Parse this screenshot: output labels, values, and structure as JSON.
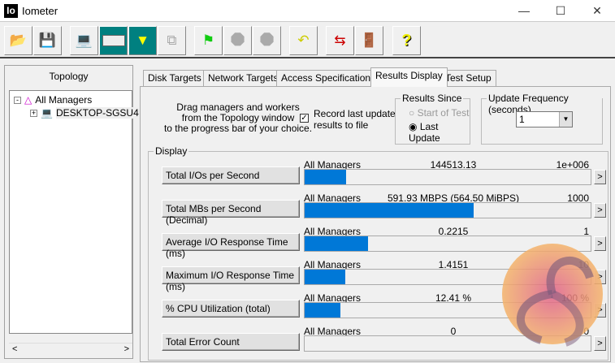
{
  "window": {
    "title": "Iometer",
    "icon_text": "Io"
  },
  "toolbar": {
    "buttons": [
      "open",
      "save",
      "start-new-manager",
      "new-disk-worker",
      "new-network-worker",
      "copy-worker",
      "start-tests",
      "stop",
      "stop-all",
      "reset-workers",
      "connect",
      "exit",
      "help"
    ]
  },
  "topology": {
    "title": "Topology",
    "root": "All Managers",
    "child": "DESKTOP-SGSU4"
  },
  "tabs": [
    "Disk Targets",
    "Network Targets",
    "Access Specifications",
    "Results Display",
    "Test Setup"
  ],
  "results": {
    "instructions": [
      "Drag managers and workers",
      "from the Topology window",
      "to the progress bar of your choice."
    ],
    "record_label": [
      "Record last update",
      "results to file"
    ],
    "record_checked": true,
    "results_since": {
      "title": "Results Since",
      "options": [
        "Start of Test",
        "Last Update"
      ],
      "selected": "Last Update"
    },
    "update_frequency": {
      "title": "Update Frequency (seconds)",
      "value": "1"
    },
    "display_title": "Display",
    "rows": [
      {
        "label": "Total I/Os per Second",
        "manager": "All Managers",
        "value": "144513.13",
        "max": "1e+006",
        "fraction": 0.1445
      },
      {
        "label": "Total MBs per Second (Decimal)",
        "manager": "All Managers",
        "value": "591.93 MBPS (564.50 MiBPS)",
        "max": "1000",
        "fraction": 0.592
      },
      {
        "label": "Average I/O Response Time (ms)",
        "manager": "All Managers",
        "value": "0.2215",
        "max": "1",
        "fraction": 0.2215
      },
      {
        "label": "Maximum I/O Response Time (ms)",
        "manager": "All Managers",
        "value": "1.4151",
        "max": "10",
        "fraction": 0.1415
      },
      {
        "label": "% CPU Utilization (total)",
        "manager": "All Managers",
        "value": "12.41 %",
        "max": "100 %",
        "fraction": 0.1241
      },
      {
        "label": "Total Error Count",
        "manager": "All Managers",
        "value": "0",
        "max": "0",
        "fraction": 0
      }
    ],
    "arrow": ">"
  }
}
